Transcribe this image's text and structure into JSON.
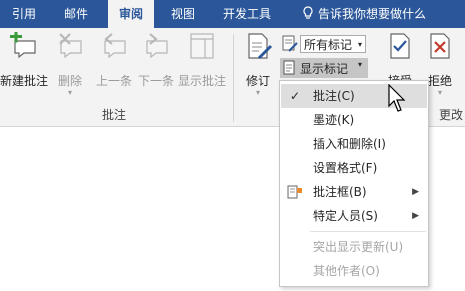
{
  "tabs": [
    {
      "label": "引用",
      "active": false
    },
    {
      "label": "邮件",
      "active": false
    },
    {
      "label": "审阅",
      "active": true
    },
    {
      "label": "视图",
      "active": false
    },
    {
      "label": "开发工具",
      "active": false
    }
  ],
  "tell_me": "告诉我你想要做什么",
  "ribbon": {
    "comments_group": {
      "label": "批注",
      "new_comment": "新建批注",
      "delete": "删除",
      "previous": "上一条",
      "next": "下一条",
      "show_comments": "显示批注"
    },
    "tracking": {
      "track_changes": "修订",
      "display_for_review": "所有标记",
      "show_markup": "显示标记"
    },
    "changes_group": {
      "accept": "接受",
      "reject": "拒绝",
      "label_partial": "更改"
    }
  },
  "show_markup_menu": {
    "items": [
      {
        "label": "批注(C)",
        "checked": true,
        "highlighted": true,
        "enabled": true
      },
      {
        "label": "墨迹(K)",
        "checked": false,
        "enabled": true
      },
      {
        "label": "插入和删除(I)",
        "checked": false,
        "enabled": true
      },
      {
        "label": "设置格式(F)",
        "checked": false,
        "enabled": true
      },
      {
        "label": "批注框(B)",
        "submenu": true,
        "enabled": true
      },
      {
        "label": "特定人员(S)",
        "submenu": true,
        "enabled": true
      },
      {
        "label": "突出显示更新(U)",
        "enabled": false
      },
      {
        "label": "其他作者(O)",
        "enabled": false
      }
    ]
  },
  "colors": {
    "tab_bar": "#2b579a",
    "ribbon_bg": "#f3f3f3",
    "menu_highlight": "#dedede",
    "disabled_text": "#a6a6a6",
    "accent_green": "#3a9a3a",
    "reject_red": "#c0392b"
  }
}
